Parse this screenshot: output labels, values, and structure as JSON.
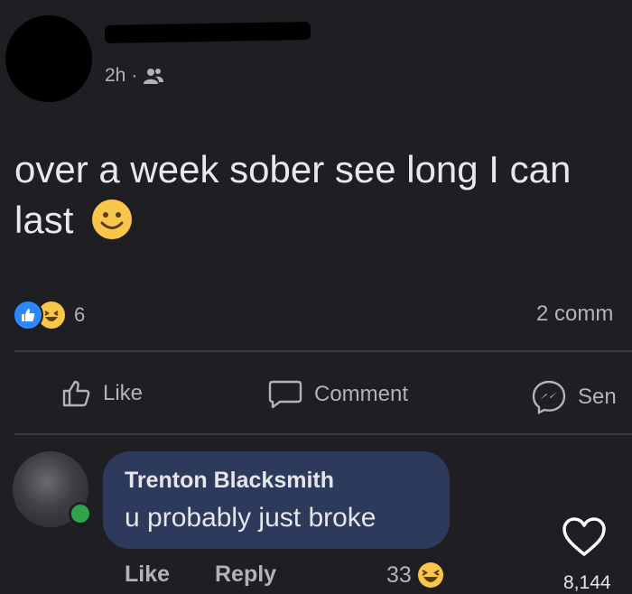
{
  "post": {
    "time": "2h",
    "separator": "·",
    "audience_icon": "friends-icon",
    "text": "over a week sober see long I can last",
    "emoji": "smiling-face-icon",
    "reaction_count": "6",
    "comments_count": "2 comm"
  },
  "actions": {
    "like_label": "Like",
    "comment_label": "Comment",
    "send_label": "Sen"
  },
  "comment": {
    "author": "Trenton Blacksmith",
    "text": "u probably just broke",
    "like_label": "Like",
    "reply_label": "Reply",
    "reaction_count": "33"
  },
  "overlay": {
    "likes": "8,144"
  },
  "colors": {
    "background": "#1f1f23",
    "comment_bubble": "#2d3a5c",
    "like_blue": "#2d88ff",
    "emoji_yellow": "#f7c64a",
    "online_green": "#31a24c"
  }
}
